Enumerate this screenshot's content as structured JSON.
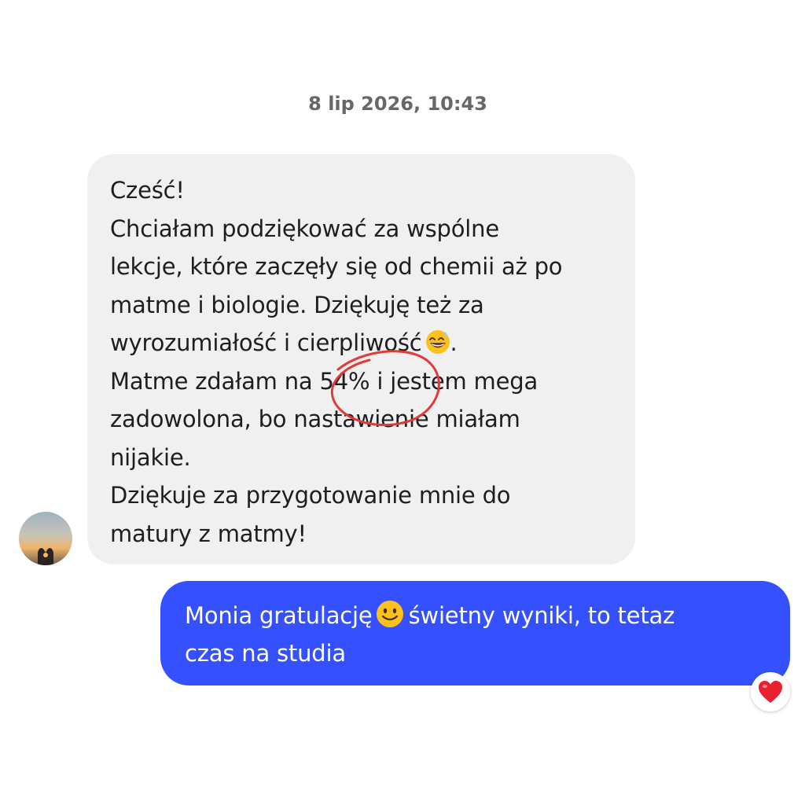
{
  "conversation": {
    "timestamp": "8 lip 2026, 10:43",
    "incoming_message": {
      "lines": [
        "Cześć!",
        "Chciałam podziękować za wspólne",
        "lekcje, które zaczęły się od chemii aż po",
        "matme i biologie. Dziękuję też za",
        "wyrozumiałość i cierpliwość",
        ".",
        "Matme zdałam na 54% i jestem mega",
        "zadowolona, bo nastawienie miałam",
        "nijakie.",
        "Dziękuje za przygotowanie mnie do",
        "matury z matmy!"
      ],
      "emoji": "grinning-sweat-emoji",
      "bubble_color": "#f0f0f0",
      "annotation_color": "#e53935"
    },
    "outgoing_message": {
      "line1_before": "Monia gratulację",
      "line1_after": "świetny wyniki, to tetaz",
      "line2": "czas na studia",
      "emoji": "slightly-smiling-emoji",
      "bubble_color": "#3550ff"
    },
    "reaction": {
      "icon": "heart-icon",
      "color": "#e8202f"
    }
  }
}
